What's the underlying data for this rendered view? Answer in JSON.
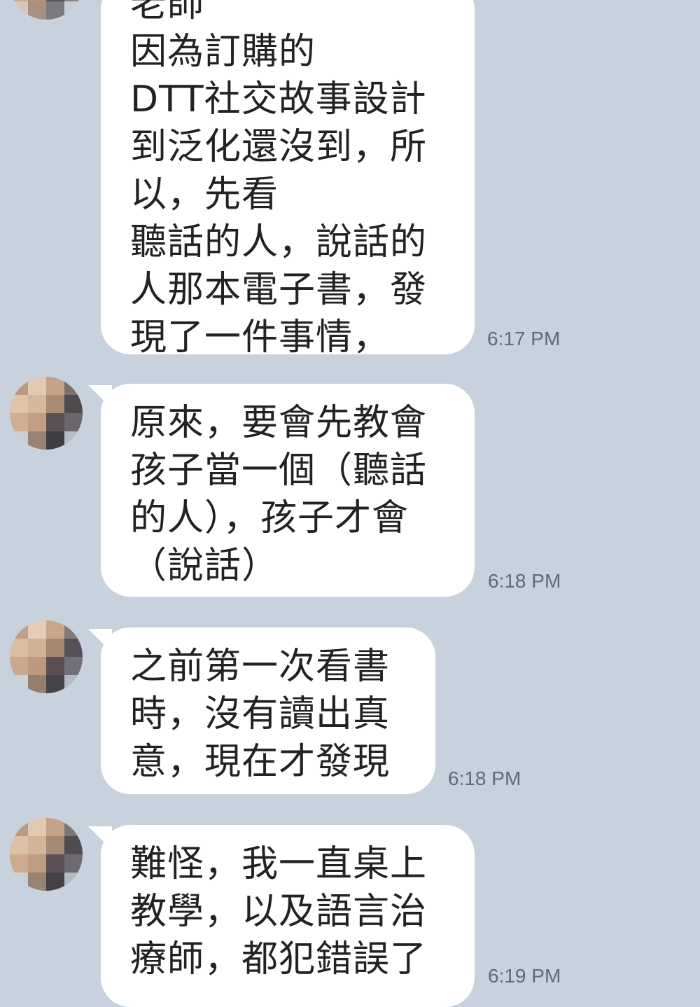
{
  "messages": [
    {
      "lines": [
        "老師",
        "因為訂購的",
        "DTT社交故事設計",
        "到泛化還沒到，所",
        "以，先看",
        "聽話的人，說話的",
        "人那本電子書，發",
        "現了一件事情，"
      ],
      "time": "6:17 PM"
    },
    {
      "lines": [
        "原來，要會先教會",
        "孩子當一個（聽話",
        "的人），孩子才會",
        "（說話）"
      ],
      "time": "6:18 PM"
    },
    {
      "lines": [
        "之前第一次看書",
        "時，沒有讀出真",
        "意，現在才發現"
      ],
      "time": "6:18 PM"
    },
    {
      "lines": [
        "難怪，我一直桌上",
        "教學，以及語言治",
        "療師，都犯錯誤了"
      ],
      "time": "6:19 PM"
    }
  ],
  "colors": {
    "background": "#c8d2de",
    "bubble": "#ffffff",
    "text": "#222222",
    "timestamp": "#606a75"
  },
  "avatar": {
    "icon": "pixelated-avatar-icon"
  }
}
